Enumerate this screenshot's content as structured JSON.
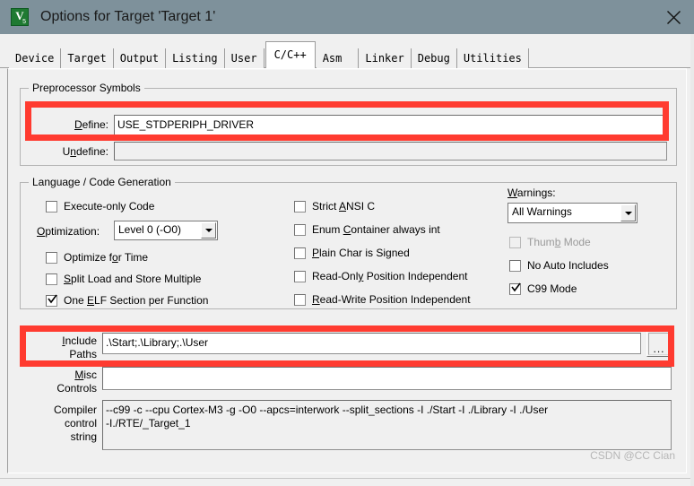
{
  "window": {
    "title": "Options for Target 'Target 1'",
    "icon": "uvision-app-icon",
    "icon_glyph": "V",
    "icon_sub": "5",
    "close_icon": "close-icon",
    "titlebar_color": "#7e919b"
  },
  "tabs": [
    {
      "label": "Device",
      "selected": false
    },
    {
      "label": "Target",
      "selected": false
    },
    {
      "label": "Output",
      "selected": false
    },
    {
      "label": "Listing",
      "selected": false
    },
    {
      "label": "User",
      "selected": false
    },
    {
      "label": "C/C++",
      "selected": true
    },
    {
      "label": "Asm",
      "selected": false
    },
    {
      "label": "Linker",
      "selected": false
    },
    {
      "label": "Debug",
      "selected": false
    },
    {
      "label": "Utilities",
      "selected": false
    }
  ],
  "preprocessor": {
    "legend": "Preprocessor Symbols",
    "define_label": "Define:",
    "define_value": "USE_STDPERIPH_DRIVER",
    "undefine_label": "Undefine:",
    "undefine_value": ""
  },
  "language": {
    "legend": "Language / Code Generation",
    "left_checks": [
      {
        "label": "Execute-only Code",
        "checked": false,
        "disabled": false
      },
      {
        "label": "Optimize for Time",
        "checked": false,
        "disabled": false
      },
      {
        "label": "Split Load and Store Multiple",
        "checked": false,
        "disabled": false
      },
      {
        "label": "One ELF Section per Function",
        "checked": true,
        "disabled": false
      }
    ],
    "optimization_label": "Optimization:",
    "optimization_value": "Level 0 (-O0)",
    "mid_checks": [
      {
        "label": "Strict ANSI C",
        "checked": false,
        "disabled": false
      },
      {
        "label": "Enum Container always int",
        "checked": false,
        "disabled": false
      },
      {
        "label": "Plain Char is Signed",
        "checked": false,
        "disabled": false
      },
      {
        "label": "Read-Only Position Independent",
        "checked": false,
        "disabled": false
      },
      {
        "label": "Read-Write Position Independent",
        "checked": false,
        "disabled": false
      }
    ],
    "warnings_label": "Warnings:",
    "warnings_value": "All Warnings",
    "right_checks": [
      {
        "label": "Thumb Mode",
        "checked": false,
        "disabled": true
      },
      {
        "label": "No Auto Includes",
        "checked": false,
        "disabled": false
      },
      {
        "label": "C99 Mode",
        "checked": true,
        "disabled": false
      }
    ]
  },
  "paths": {
    "include_label_line1": "Include",
    "include_label_line2": "Paths",
    "include_value": ".\\Start;.\\Library;.\\User",
    "browse_label": "...",
    "misc_label_line1": "Misc",
    "misc_label_line2": "Controls",
    "misc_value": "",
    "compiler_label_line1": "Compiler",
    "compiler_label_line2": "control",
    "compiler_label_line3": "string",
    "compiler_value": "--c99 -c --cpu Cortex-M3 -g -O0 --apcs=interwork --split_sections -I ./Start -I ./Library -I ./User\n-I./RTE/_Target_1"
  },
  "annotations": {
    "highlight_color": "#ff3b30",
    "watermark": "CSDN @CC Cian"
  }
}
